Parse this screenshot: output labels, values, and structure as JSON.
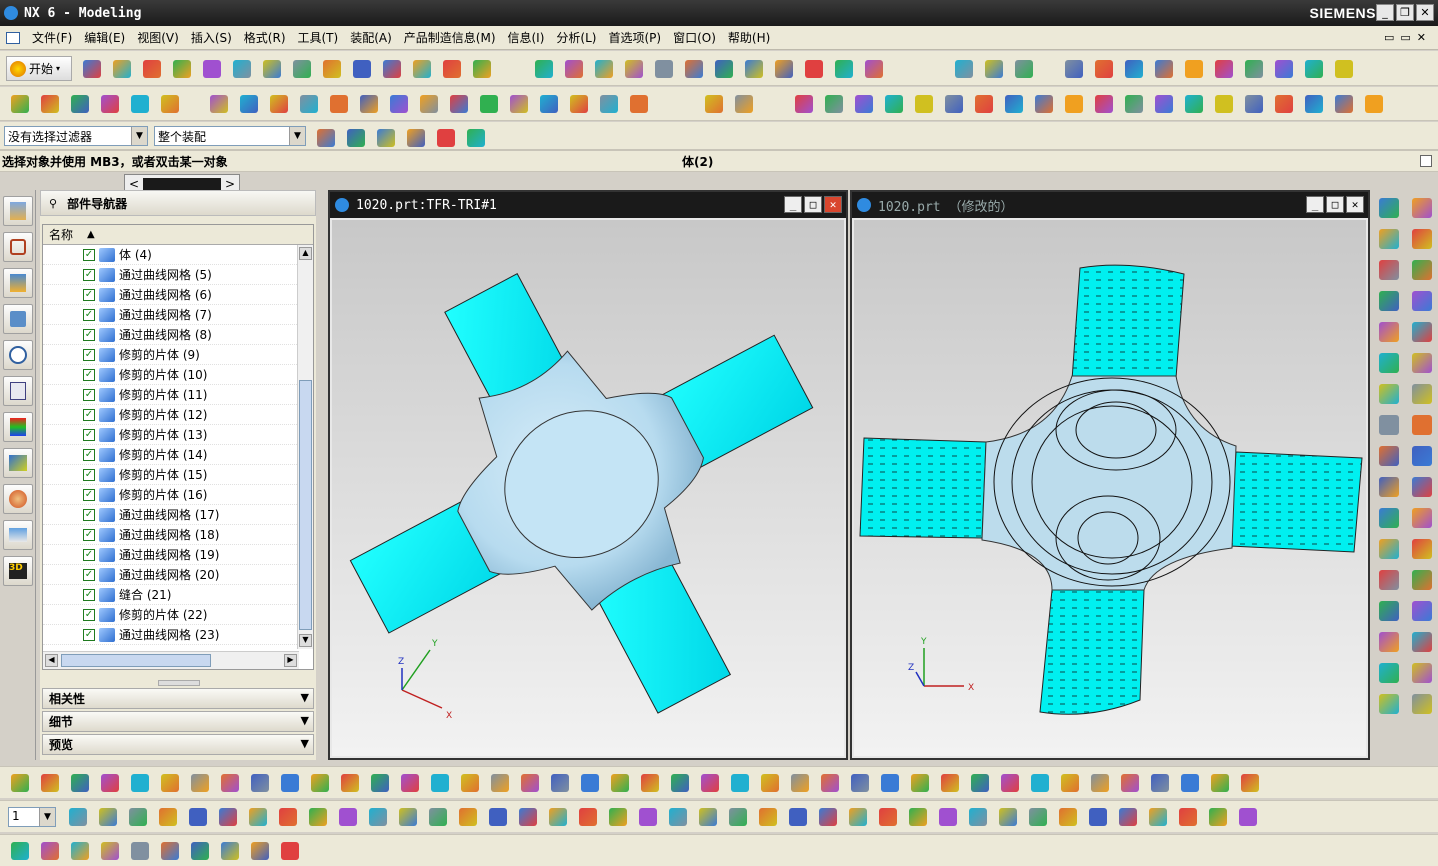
{
  "titlebar": {
    "title": "NX 6 - Modeling",
    "brand": "SIEMENS",
    "min": "_",
    "restore": "❐",
    "close": "✕"
  },
  "menu": [
    "文件(F)",
    "编辑(E)",
    "视图(V)",
    "插入(S)",
    "格式(R)",
    "工具(T)",
    "装配(A)",
    "产品制造信息(M)",
    "信息(I)",
    "分析(L)",
    "首选项(P)",
    "窗口(O)",
    "帮助(H)"
  ],
  "toolbar": {
    "start_label": "开始",
    "filter_value": "没有选择过滤器",
    "assembly_value": "整个装配"
  },
  "status": {
    "prompt": "选择对象并使用 MB3，或者双击某一对象",
    "selection": "体(2)"
  },
  "navigator": {
    "title": "部件导航器",
    "column": "名称",
    "items": [
      {
        "label": "体 (4)",
        "icon": "body-icon",
        "state": "check"
      },
      {
        "label": "通过曲线网格 (5)",
        "icon": "surface-icon",
        "state": "check"
      },
      {
        "label": "通过曲线网格 (6)",
        "icon": "surface-icon",
        "state": "check"
      },
      {
        "label": "通过曲线网格 (7)",
        "icon": "surface-icon",
        "state": "check"
      },
      {
        "label": "通过曲线网格 (8)",
        "icon": "surface-icon",
        "state": "check"
      },
      {
        "label": "修剪的片体 (9)",
        "icon": "trim-icon",
        "state": "check"
      },
      {
        "label": "修剪的片体 (10)",
        "icon": "trim-icon",
        "state": "check"
      },
      {
        "label": "修剪的片体 (11)",
        "icon": "trim-icon",
        "state": "check"
      },
      {
        "label": "修剪的片体 (12)",
        "icon": "trim-icon",
        "state": "check"
      },
      {
        "label": "修剪的片体 (13)",
        "icon": "trim-icon",
        "state": "check"
      },
      {
        "label": "修剪的片体 (14)",
        "icon": "trim-icon",
        "state": "check"
      },
      {
        "label": "修剪的片体 (15)",
        "icon": "trim-icon",
        "state": "check"
      },
      {
        "label": "修剪的片体 (16)",
        "icon": "trim-icon",
        "state": "check"
      },
      {
        "label": "通过曲线网格 (17)",
        "icon": "surface-icon",
        "state": "info"
      },
      {
        "label": "通过曲线网格 (18)",
        "icon": "surface-icon",
        "state": "info"
      },
      {
        "label": "通过曲线网格 (19)",
        "icon": "surface-icon",
        "state": "info"
      },
      {
        "label": "通过曲线网格 (20)",
        "icon": "surface-icon",
        "state": "info"
      },
      {
        "label": "缝合 (21)",
        "icon": "sew-icon",
        "state": "check"
      },
      {
        "label": "修剪的片体 (22)",
        "icon": "trim-icon",
        "state": "check"
      },
      {
        "label": "通过曲线网格 (23)",
        "icon": "surface-icon",
        "state": "check"
      }
    ],
    "panels": [
      "相关性",
      "细节",
      "预览"
    ]
  },
  "viewports": [
    {
      "title": "1020.prt:TFR-TRI#1",
      "active": true
    },
    {
      "title": "1020.prt （修改的）",
      "active": false
    }
  ],
  "axis_labels": {
    "x": "X",
    "y": "Y",
    "z": "Z"
  },
  "colors": {
    "cyan": "#00f0f0",
    "hub": "#b9dcf0",
    "titlebar": "#1a1a1a"
  }
}
